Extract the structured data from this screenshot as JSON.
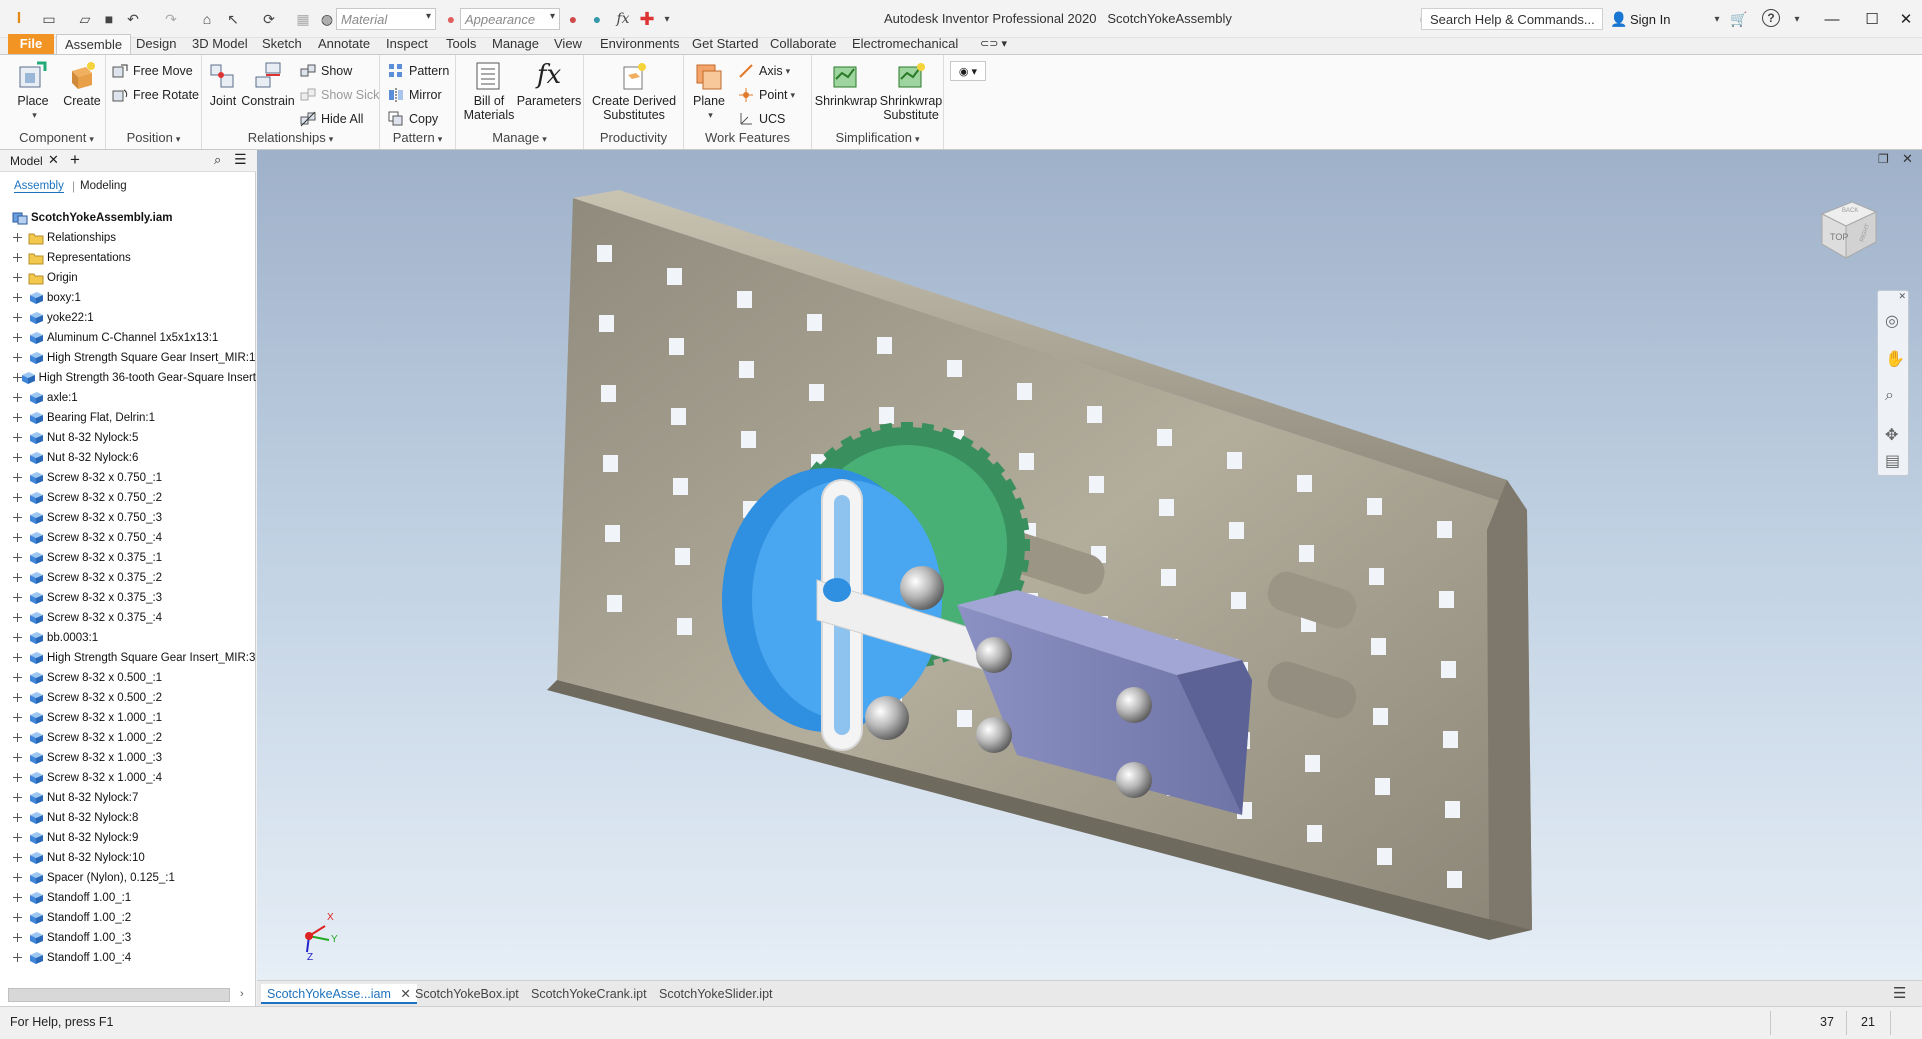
{
  "window": {
    "app_title": "Autodesk Inventor Professional 2020",
    "document_title": "ScotchYokeAssembly",
    "search_placeholder": "Search Help & Commands...",
    "sign_in": "Sign In"
  },
  "quick_access": {
    "material_label": "Material",
    "appearance_label": "Appearance"
  },
  "tabs": [
    {
      "label": "File"
    },
    {
      "label": "Assemble"
    },
    {
      "label": "Design"
    },
    {
      "label": "3D Model"
    },
    {
      "label": "Sketch"
    },
    {
      "label": "Annotate"
    },
    {
      "label": "Inspect"
    },
    {
      "label": "Tools"
    },
    {
      "label": "Manage"
    },
    {
      "label": "View"
    },
    {
      "label": "Environments"
    },
    {
      "label": "Get Started"
    },
    {
      "label": "Collaborate"
    },
    {
      "label": "Electromechanical"
    }
  ],
  "ribbon": {
    "component": {
      "label": "Component",
      "place": "Place",
      "create": "Create"
    },
    "position": {
      "label": "Position",
      "free_move": "Free Move",
      "free_rotate": "Free Rotate"
    },
    "relationships": {
      "label": "Relationships",
      "joint": "Joint",
      "constrain": "Constrain",
      "show": "Show",
      "show_sick": "Show Sick",
      "hide_all": "Hide All"
    },
    "pattern": {
      "label": "Pattern",
      "pattern": "Pattern",
      "mirror": "Mirror",
      "copy": "Copy"
    },
    "manage": {
      "label": "Manage",
      "bom_line1": "Bill of",
      "bom_line2": "Materials",
      "parameters": "Parameters"
    },
    "productivity": {
      "label": "Productivity",
      "derived_line1": "Create Derived",
      "derived_line2": "Substitutes"
    },
    "work_features": {
      "label": "Work Features",
      "plane": "Plane",
      "axis": "Axis",
      "point": "Point",
      "ucs": "UCS"
    },
    "simplification": {
      "label": "Simplification",
      "shrinkwrap": "Shrinkwrap",
      "shrinkwrap_sub_line1": "Shrinkwrap",
      "shrinkwrap_sub_line2": "Substitute"
    }
  },
  "browser": {
    "title": "Model",
    "tab_assembly": "Assembly",
    "tab_modeling": "Modeling",
    "root": "ScotchYokeAssembly.iam",
    "items": [
      {
        "label": "Relationships",
        "icon": "folder"
      },
      {
        "label": "Representations",
        "icon": "folder"
      },
      {
        "label": "Origin",
        "icon": "folder"
      },
      {
        "label": "boxy:1",
        "icon": "part"
      },
      {
        "label": "yoke22:1",
        "icon": "part"
      },
      {
        "label": "Aluminum C-Channel 1x5x1x13:1",
        "icon": "part"
      },
      {
        "label": "High Strength Square Gear Insert_MIR:1",
        "icon": "part"
      },
      {
        "label": "High Strength 36-tooth Gear-Square Insert",
        "icon": "part"
      },
      {
        "label": "axle:1",
        "icon": "part"
      },
      {
        "label": "Bearing Flat, Delrin:1",
        "icon": "part"
      },
      {
        "label": "Nut 8-32 Nylock:5",
        "icon": "part"
      },
      {
        "label": "Nut 8-32 Nylock:6",
        "icon": "part"
      },
      {
        "label": "Screw 8-32 x 0.750_:1",
        "icon": "part"
      },
      {
        "label": "Screw 8-32 x 0.750_:2",
        "icon": "part"
      },
      {
        "label": "Screw 8-32 x 0.750_:3",
        "icon": "part"
      },
      {
        "label": "Screw 8-32 x 0.750_:4",
        "icon": "part"
      },
      {
        "label": "Screw 8-32 x 0.375_:1",
        "icon": "part"
      },
      {
        "label": "Screw 8-32 x 0.375_:2",
        "icon": "part"
      },
      {
        "label": "Screw 8-32 x 0.375_:3",
        "icon": "part"
      },
      {
        "label": "Screw 8-32 x 0.375_:4",
        "icon": "part"
      },
      {
        "label": "bb.0003:1",
        "icon": "part"
      },
      {
        "label": "High Strength Square Gear Insert_MIR:3",
        "icon": "part"
      },
      {
        "label": "Screw 8-32 x 0.500_:1",
        "icon": "part"
      },
      {
        "label": "Screw 8-32 x 0.500_:2",
        "icon": "part"
      },
      {
        "label": "Screw 8-32 x 1.000_:1",
        "icon": "part"
      },
      {
        "label": "Screw 8-32 x 1.000_:2",
        "icon": "part"
      },
      {
        "label": "Screw 8-32 x 1.000_:3",
        "icon": "part"
      },
      {
        "label": "Screw 8-32 x 1.000_:4",
        "icon": "part"
      },
      {
        "label": "Nut 8-32 Nylock:7",
        "icon": "part"
      },
      {
        "label": "Nut 8-32 Nylock:8",
        "icon": "part"
      },
      {
        "label": "Nut 8-32 Nylock:9",
        "icon": "part"
      },
      {
        "label": "Nut 8-32 Nylock:10",
        "icon": "part"
      },
      {
        "label": "Spacer (Nylon), 0.125_:1",
        "icon": "part"
      },
      {
        "label": "Standoff 1.00_:1",
        "icon": "part"
      },
      {
        "label": "Standoff 1.00_:2",
        "icon": "part"
      },
      {
        "label": "Standoff 1.00_:3",
        "icon": "part"
      },
      {
        "label": "Standoff 1.00_:4",
        "icon": "part"
      }
    ]
  },
  "viewcube": {
    "face_top": "TOP",
    "face_right": "RIGHT",
    "face_back": "BACK"
  },
  "triad": {
    "x": "X",
    "y": "Y",
    "z": "Z"
  },
  "document_tabs": [
    {
      "label": "ScotchYokeAsse...iam",
      "active": true
    },
    {
      "label": "ScotchYokeBox.ipt",
      "active": false
    },
    {
      "label": "ScotchYokeCrank.ipt",
      "active": false
    },
    {
      "label": "ScotchYokeSlider.ipt",
      "active": false
    }
  ],
  "status": {
    "help": "For Help, press F1",
    "count1": "37",
    "count2": "21"
  },
  "colors": {
    "accent": "#1e73be",
    "file_tab": "#f29423",
    "gear_green": "#3fa36b",
    "crank_blue": "#2f8fe0",
    "slider_purple": "#7a7fb0",
    "channel": "#a7a08e"
  }
}
